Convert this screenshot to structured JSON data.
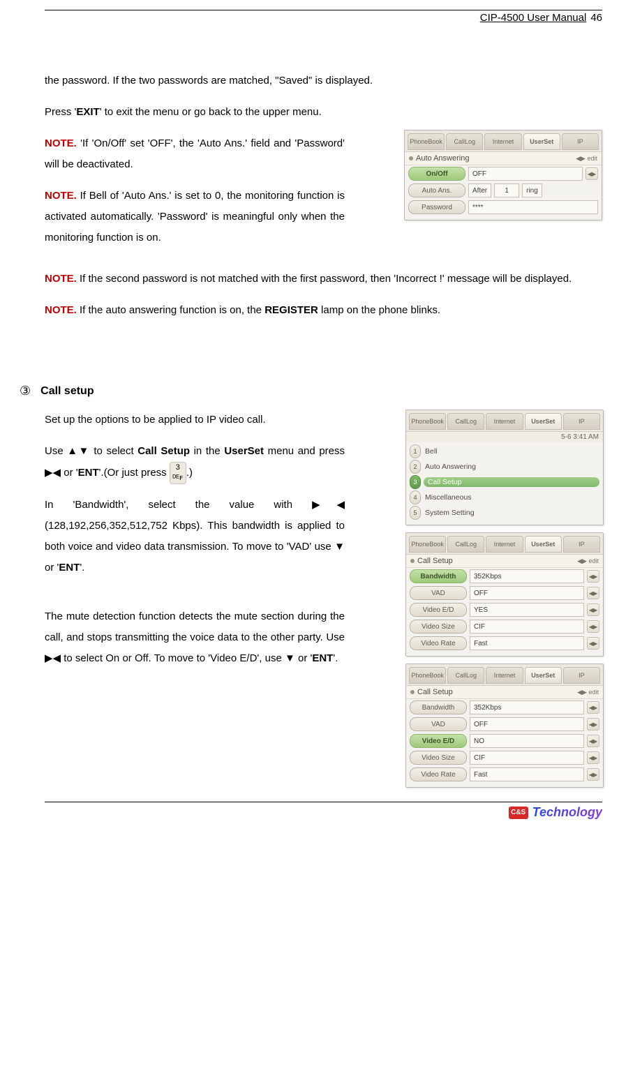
{
  "header": {
    "doc_title": "CIP-4500 User Manual",
    "page_no": "46"
  },
  "footer": {
    "badge": "C&S",
    "brand": "Technology"
  },
  "p_intro_a": "the password. If the two passwords are matched, \"Saved\" is displayed.",
  "p_exit_prefix": "  Press '",
  "k_exit": "EXIT",
  "p_exit_suffix": "' to exit the menu or go back to the upper menu.",
  "note_label": "NOTE.",
  "note1_body": " 'If 'On/Off' set 'OFF', the 'Auto Ans.' field and 'Password' will be deactivated.",
  "note2_body": " If Bell of 'Auto Ans.' is set to 0, the monitoring function is activated automatically. 'Password' is meaningful only when the monitoring function is on.",
  "note3_body": " If the second password is not matched with the first password, then 'Incorrect !' message will be displayed.",
  "note4_prefix": " If the auto answering function is on, the ",
  "note4_bold": "REGISTER",
  "note4_suffix": " lamp on the phone blinks.",
  "section3": {
    "num": "③",
    "title": "Call setup",
    "p1": "Set up the options to be applied to IP video call.",
    "p2_a": "  Use ▲▼ to select ",
    "p2_bold1": "Call Setup",
    "p2_b": " in the ",
    "p2_bold2": "UserSet",
    "p2_c": " menu and press ▶◀ or '",
    "p2_bold3": "ENT",
    "p2_d": "'.(Or just press ",
    "p2_key": "3 ᴰᴱꜰ",
    "p2_e": ".)",
    "p3_a": "  In 'Bandwidth', select the value with ▶◀ (128,192,256,352,512,752 Kbps). This bandwidth is applied to both voice and video data transmission. To move to 'VAD' use ▼ or '",
    "p3_bold": "ENT",
    "p3_b": "'.",
    "p4_a": "  The mute detection function detects the mute section during the call, and stops transmitting the voice data to the other party. Use ▶◀ to select On or Off. To move to 'Video E/D', use ▼ or '",
    "p4_bold": "ENT",
    "p4_b": "'."
  },
  "tabs": {
    "phonebook": "PhoneBook",
    "calllog": "CallLog",
    "internet": "Internet",
    "userset": "UserSet",
    "ip": "IP"
  },
  "screen_top": {
    "title": "Auto Answering",
    "edit": "◀▶ edit",
    "row1_label": "On/Off",
    "row1_value": "OFF",
    "row2_label": "Auto Ans.",
    "row2_value_pre": "After",
    "row2_value_num": "1",
    "row2_value_post": "ring",
    "row3_label": "Password",
    "row3_value": "****"
  },
  "screen_menu": {
    "sub": "5-6  3:41 AM",
    "items": [
      {
        "n": "1",
        "label": "Bell"
      },
      {
        "n": "2",
        "label": "Auto Answering"
      },
      {
        "n": "3",
        "label": "Call Setup"
      },
      {
        "n": "4",
        "label": "Miscellaneous"
      },
      {
        "n": "5",
        "label": "System Setting"
      }
    ]
  },
  "screen_cs1": {
    "title": "Call Setup",
    "edit": "◀▶ edit",
    "rows": [
      {
        "label": "Bandwidth",
        "value": "352Kbps"
      },
      {
        "label": "VAD",
        "value": "OFF"
      },
      {
        "label": "Video E/D",
        "value": "YES"
      },
      {
        "label": "Video Size",
        "value": "CIF"
      },
      {
        "label": "Video Rate",
        "value": "Fast"
      }
    ]
  },
  "screen_cs2": {
    "title": "Call Setup",
    "edit": "◀▶ edit",
    "rows": [
      {
        "label": "Bandwidth",
        "value": "352Kbps"
      },
      {
        "label": "VAD",
        "value": "OFF"
      },
      {
        "label": "Video E/D",
        "value": "NO"
      },
      {
        "label": "Video Size",
        "value": "CIF"
      },
      {
        "label": "Video Rate",
        "value": "Fast"
      }
    ]
  },
  "arrow_btn": "◀▶"
}
